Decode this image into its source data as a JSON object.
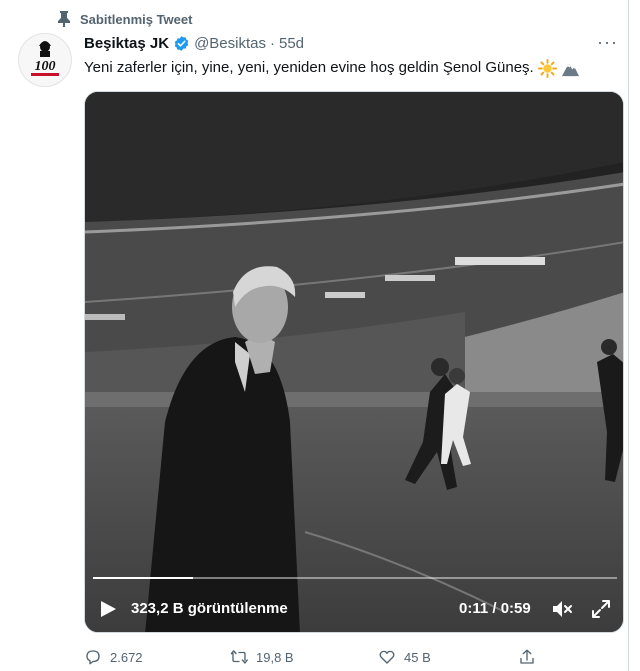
{
  "pinned": {
    "label": "Sabitlenmiş Tweet"
  },
  "tweet": {
    "author_name": "Beşiktaş JK",
    "handle": "@Besiktas",
    "separator": "·",
    "time": "55d",
    "more": "···",
    "text": "Yeni zaferler için, yine, yeni, yeniden evine hoş geldin Şenol Güneş."
  },
  "avatar": {
    "badge_text": "100"
  },
  "video": {
    "views": "323,2 B görüntülenme",
    "timer": "0:11 / 0:59",
    "progress": 0.19
  },
  "actions": {
    "replies": "2.672",
    "retweets": "19,8 B",
    "likes": "45 B"
  },
  "colors": {
    "secondary_text": "#536471",
    "verified_blue": "#1d9bf0",
    "avatar_red": "#c8102e"
  }
}
